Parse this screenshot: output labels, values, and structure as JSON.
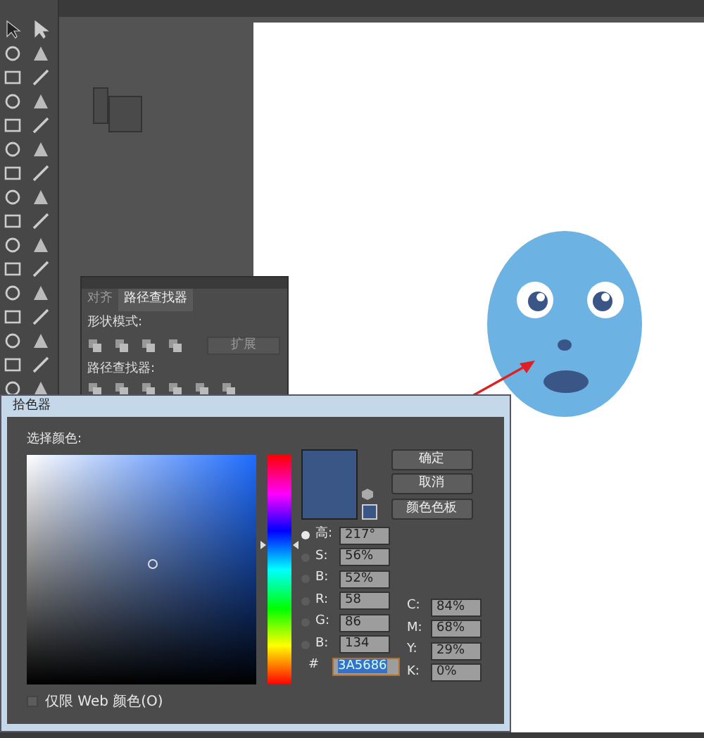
{
  "pathfinder_panel": {
    "tabs": [
      {
        "label": "对齐",
        "selected": false
      },
      {
        "label": "路径查找器",
        "selected": true
      }
    ],
    "shape_modes_label": "形状模式:",
    "expand_button": "扩展",
    "pathfinders_label": "路径查找器:"
  },
  "color_picker": {
    "title": "拾色器",
    "select_color_label": "选择颜色:",
    "hue_slider": {
      "level": 0.61
    },
    "buttons": [
      "确定",
      "取消",
      "颜色色板"
    ],
    "hsb_rgb": [
      {
        "label": "高:",
        "value": "217°",
        "selected": true
      },
      {
        "label": "S:",
        "value": "56%",
        "selected": false
      },
      {
        "label": "B:",
        "value": "52%",
        "selected": false
      },
      {
        "label": "R:",
        "value": "58",
        "selected": false
      },
      {
        "label": "G:",
        "value": "86",
        "selected": false
      },
      {
        "label": "B:",
        "value": "134",
        "selected": false
      }
    ],
    "cmyk": [
      {
        "label": "C:",
        "value": "84%"
      },
      {
        "label": "M:",
        "value": "68%"
      },
      {
        "label": "Y:",
        "value": "29%"
      },
      {
        "label": "K:",
        "value": "0%"
      }
    ],
    "hex": {
      "label": "#",
      "value": "3A5686"
    },
    "web_only": {
      "label": "仅限 Web 颜色(O)",
      "checked": false
    }
  }
}
